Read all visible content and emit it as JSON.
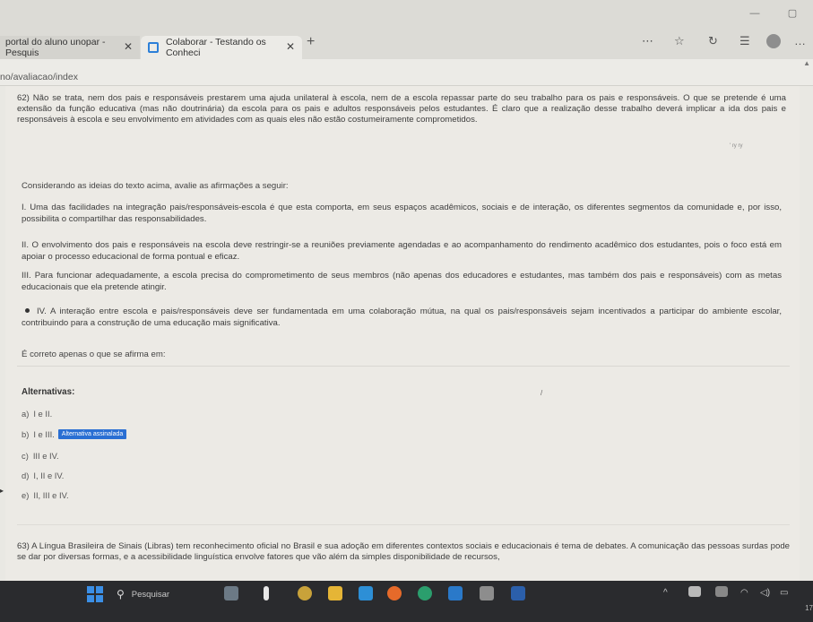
{
  "window": {
    "minimize": "—",
    "restore": "▢"
  },
  "tabs": [
    {
      "title": "portal do aluno unopar - Pesquis",
      "close": "✕"
    },
    {
      "title": "Colaborar - Testando os Conheci",
      "close": "✕"
    }
  ],
  "toolbar": {
    "new_tab": "+",
    "reading_view": "⋯",
    "favorite": "☆",
    "refresh": "↻",
    "collections": "☰",
    "menu": "…"
  },
  "address": {
    "url": "no/avaliacao/index",
    "scroll_up": "▲"
  },
  "question62": {
    "text": "62)  Não se trata, nem dos pais e responsáveis prestarem uma ajuda unilateral à escola, nem de a escola repassar parte do seu trabalho para os pais e responsáveis. O que se pretende é uma extensão da função educativa (mas não doutrinária) da escola para os pais e adultos responsáveis pelos estudantes. É claro que a realização desse trabalho deverá implicar a ida dos pais e responsáveis à escola e seu envolvimento em atividades com as quais eles não estão costumeiramente comprometidos.",
    "stray": "' ry ry",
    "prompt": "Considerando as ideias do texto acima, avalie as afirmações a seguir:",
    "statements": [
      "I. Uma das facilidades na integração pais/responsáveis-escola é que esta comporta, em seus espaços acadêmicos, sociais e de interação, os diferentes segmentos da comunidade e, por isso, possibilita o compartilhar das responsabilidades.",
      "II. O envolvimento dos pais e responsáveis na escola deve restringir-se a reuniões previamente agendadas e ao acompanhamento do rendimento acadêmico dos estudantes, pois o foco está em apoiar o processo educacional de forma pontual e eficaz.",
      "III. Para funcionar adequadamente, a escola precisa do comprometimento de seus membros (não apenas dos educadores e estudantes, mas também dos pais e responsáveis) com as metas educacionais que ela pretende atingir.",
      "IV. A interação entre escola e pais/responsáveis deve ser fundamentada em uma colaboração mútua, na qual os pais/responsáveis sejam incentivados a participar do ambiente escolar, contribuindo para a construção de uma educação mais significativa."
    ],
    "correct_prompt": "É correto apenas o que se afirma em:",
    "alternatives_title": "Alternativas:",
    "cursor": "/",
    "alternatives": [
      {
        "letter": "a)",
        "text": "I e II."
      },
      {
        "letter": "b)",
        "text": "I e III.",
        "badge": "Alternativa assinalada"
      },
      {
        "letter": "c)",
        "text": "III e IV."
      },
      {
        "letter": "d)",
        "text": "I, II e IV."
      },
      {
        "letter": "e)",
        "text": "II, III e IV."
      }
    ],
    "side_arrow": "▸"
  },
  "question63": {
    "text": "63)  A Língua Brasileira de Sinais (Libras) tem reconhecimento oficial no Brasil e sua adoção em diferentes contextos sociais e educacionais é tema de debates. A comunicação das pessoas surdas pode se dar por diversas formas, e a acessibilidade linguística envolve fatores que vão além da simples disponibilidade de recursos,"
  },
  "taskbar": {
    "search_placeholder": "Pesquisar",
    "search_glyph": "⚲",
    "tray_chevron": "^",
    "wifi": "◠",
    "volume": "◁)",
    "battery": "▭",
    "clock": "17",
    "colors": {
      "start": "#3b8fe6",
      "accent_badge": "#2a6fd3"
    }
  }
}
